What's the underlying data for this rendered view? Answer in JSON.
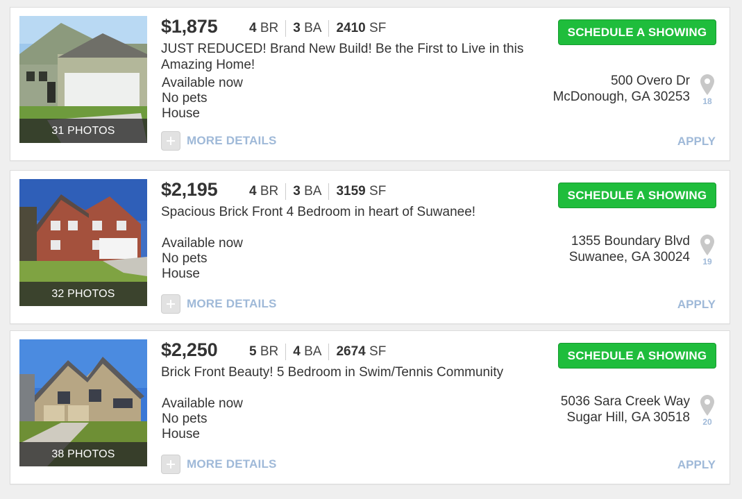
{
  "listings": [
    {
      "price": "$1,875",
      "beds": "4",
      "beds_label": "BR",
      "baths": "3",
      "baths_label": "BA",
      "sqft": "2410",
      "sqft_label": "SF",
      "headline": "JUST REDUCED! Brand New Build! Be the First to Live in this Amazing Home!",
      "availability": "Available now",
      "pets": "No pets",
      "property_type": "House",
      "photo_count": "31 PHOTOS",
      "address_line1": "500 Overo Dr",
      "address_line2": "McDonough, GA 30253",
      "map_pin_number": "18",
      "schedule_label": "SCHEDULE A SHOWING",
      "more_details_label": "MORE DETAILS",
      "apply_label": "APPLY"
    },
    {
      "price": "$2,195",
      "beds": "4",
      "beds_label": "BR",
      "baths": "3",
      "baths_label": "BA",
      "sqft": "3159",
      "sqft_label": "SF",
      "headline": "Spacious Brick Front 4 Bedroom in heart of Suwanee!",
      "availability": "Available now",
      "pets": "No pets",
      "property_type": "House",
      "photo_count": "32 PHOTOS",
      "address_line1": "1355 Boundary Blvd",
      "address_line2": "Suwanee, GA 30024",
      "map_pin_number": "19",
      "schedule_label": "SCHEDULE A SHOWING",
      "more_details_label": "MORE DETAILS",
      "apply_label": "APPLY"
    },
    {
      "price": "$2,250",
      "beds": "5",
      "beds_label": "BR",
      "baths": "4",
      "baths_label": "BA",
      "sqft": "2674",
      "sqft_label": "SF",
      "headline": "Brick Front Beauty! 5 Bedroom in Swim/Tennis Community",
      "availability": "Available now",
      "pets": "No pets",
      "property_type": "House",
      "photo_count": "38 PHOTOS",
      "address_line1": "5036 Sara Creek Way",
      "address_line2": "Sugar Hill, GA 30518",
      "map_pin_number": "20",
      "schedule_label": "SCHEDULE A SHOWING",
      "more_details_label": "MORE DETAILS",
      "apply_label": "APPLY"
    }
  ],
  "colors": {
    "schedule_button": "#1fbd3c",
    "link_blue": "#9fb9d8",
    "page_background": "#efefef"
  },
  "icons": [
    "plus-icon",
    "map-pin-icon"
  ]
}
